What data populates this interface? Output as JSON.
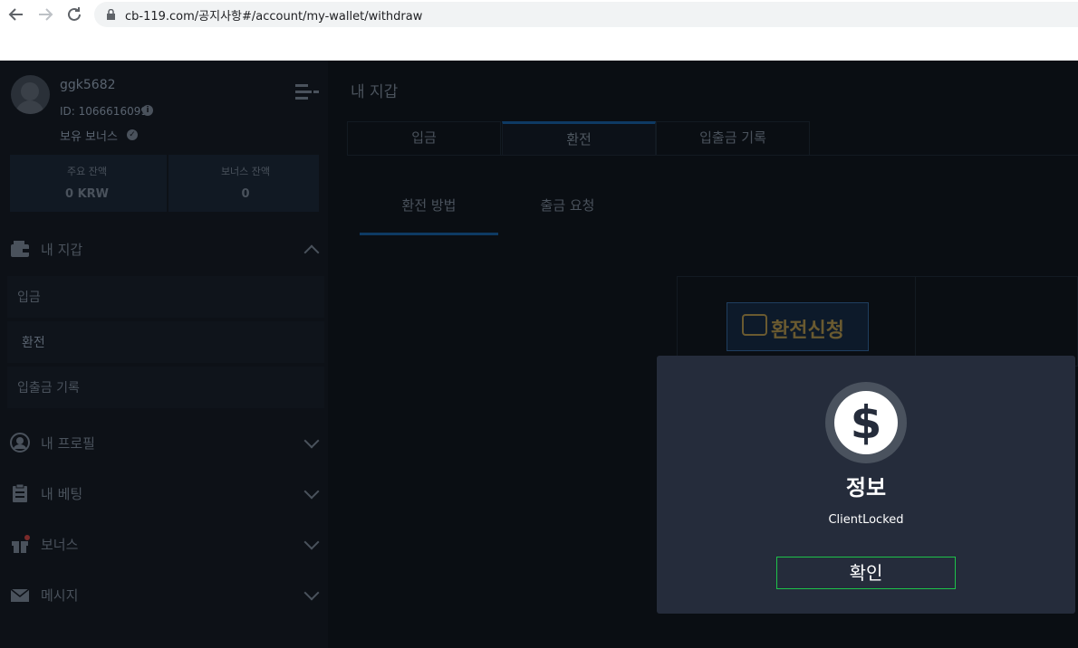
{
  "browser": {
    "url": "cb-119.com/공지사항#/account/my-wallet/withdraw",
    "back_icon": "arrow-left-icon",
    "forward_icon": "arrow-right-icon",
    "reload_icon": "reload-icon"
  },
  "user": {
    "name": "ggk5682",
    "id": "ID: 1066616099",
    "bonus_label": "보유 보너스"
  },
  "balances": {
    "main_label": "주요 잔액",
    "main_value": "0 KRW",
    "bonus_label": "보너스 잔액",
    "bonus_value": "0"
  },
  "sidebar": {
    "wallet": {
      "label": "내 지갑",
      "items": [
        {
          "label": "입금"
        },
        {
          "label": "환전"
        },
        {
          "label": "입출금 기록"
        }
      ]
    },
    "profile": {
      "label": "내 프로필"
    },
    "betting": {
      "label": "내 베팅"
    },
    "bonus": {
      "label": "보너스"
    },
    "message": {
      "label": "메시지"
    }
  },
  "main": {
    "title": "내 지갑",
    "tabs": [
      {
        "label": "입금"
      },
      {
        "label": "환전"
      },
      {
        "label": "입출금 기록"
      }
    ],
    "subtabs": [
      {
        "label": "환전 방법"
      },
      {
        "label": "출금 요청"
      }
    ],
    "banner_text": "환전신청"
  },
  "modal": {
    "icon": "dollar-icon",
    "icon_glyph": "$",
    "title": "정보",
    "message": "ClientLocked",
    "confirm_label": "확인"
  },
  "colors": {
    "modal_bg": "#252c3b",
    "confirm_border": "#1ec24a",
    "app_bg": "#0a0e13"
  }
}
